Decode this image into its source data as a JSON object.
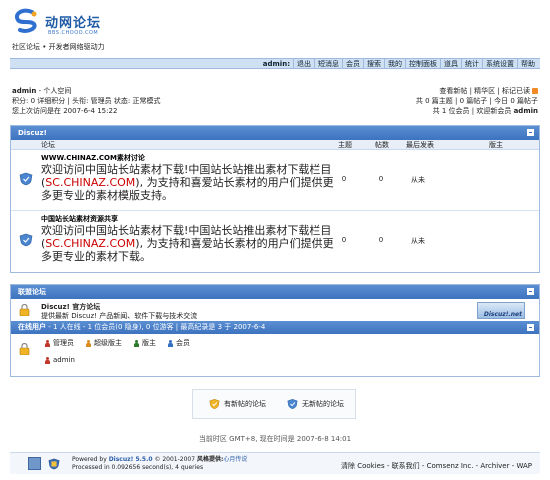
{
  "header": {
    "logo_text": "动网论坛",
    "logo_sub": "BBS.CHOOO.COM",
    "slogan": "社区论坛 • 开发者网络驱动力"
  },
  "nav": {
    "items": [
      "admin:",
      "退出",
      "短消息",
      "会员",
      "搜索",
      "我的",
      "控制面板",
      "道具",
      "统计",
      "系统设置",
      "帮助"
    ]
  },
  "user": {
    "line1_name": "admin",
    "line1_rest": " - 个人空间",
    "line2": "积分: 0 详细积分 | 头衔: 管理员 状态: 正常模式",
    "line3": "您上次访问是在 2007-6-4 15:22",
    "right1": "查看新帖 | 精华区 | 标记已读",
    "right2": "共 0 篇主题 | 0 篇帖子 | 今日 0 篇帖子",
    "right3_pre": "共 1 位会员 | 欢迎新会员 ",
    "right3_name": "admin"
  },
  "forum_box": {
    "title": "Discuz!",
    "headers": {
      "forum": "论坛",
      "topics": "主题",
      "posts": "帖数",
      "last": "最后发表",
      "mod": "版主"
    },
    "forums": [
      {
        "name": "WWW.CHINAZ.COM素材讨论",
        "desc_a": "欢迎访问中国站长站素材下载!中国站长站推出素材下载栏目(",
        "desc_red": "SC.CHINAZ.COM",
        "desc_b": "), 为支持和喜爱站长素材的用户们提供更多更专业的素材模版支持。",
        "topics": "0",
        "posts": "0",
        "last": "从未"
      },
      {
        "name": "中国站长站素材资源共享",
        "desc_a": "欢迎访问中国站长站素材下载!中国站长站推出素材下载栏目(",
        "desc_red": "SC.CHINAZ.COM",
        "desc_b": "), 为支持和喜爱站长素材的用户们提供更多更专业的素材下载。",
        "topics": "0",
        "posts": "0",
        "last": "从未"
      }
    ]
  },
  "partner_box": {
    "title": "联盟论坛",
    "name": "Discuz! 官方论坛",
    "desc": "提供最新 Discuz! 产品新闻、软件下载与技术交流",
    "badge": "Discuz!.net"
  },
  "online": {
    "label": "在线用户",
    "text": " - 1 人在线 - 1 位会员(0 隐身), 0 位游客 | 最高纪录是 3 于 2007-6-4",
    "legend": [
      "管理员",
      "超级版主",
      "版主",
      "会员"
    ],
    "legend_colors": [
      "#c0392b",
      "#d98b1e",
      "#2a7a2a",
      "#3370c0"
    ],
    "users": [
      "admin"
    ]
  },
  "legend_box": {
    "new_label": "有新帖的论坛",
    "nonew_label": "无新帖的论坛"
  },
  "footer": {
    "time": "当前时区 GMT+8, 现在时间是 2007-6-8 14:01",
    "powered_pre": "Powered by ",
    "powered_name": "Discuz! 5.5.0",
    "copyright": " © 2001-2007 ",
    "style_label": "风格提供:",
    "style_name": "心月传说",
    "processed": "Processed in 0.092656 second(s), 4 queries",
    "links": "清除 Cookies - 联系我们 - Comsenz Inc. - Archiver - WAP"
  }
}
